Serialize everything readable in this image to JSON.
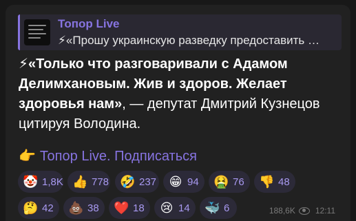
{
  "reply": {
    "title": "Топор Live",
    "text": "⚡«Прошу украинскую разведку предоставить …"
  },
  "message": {
    "emoji": "⚡",
    "bold_text": "«Только что разговаривали с Адамом Делимхановым. Жив и здоров. Желает здоровья нам»",
    "rest_text": ", — депутат Дмитрий Кузнецов цитируя Володина."
  },
  "subscribe": {
    "emoji": "👉",
    "link_text": "Топор Live. Подписаться"
  },
  "reactions": [
    {
      "icon": "clown-face-icon",
      "emoji": "🤡",
      "count": "1,8K"
    },
    {
      "icon": "thumbs-up-icon",
      "emoji": "👍",
      "count": "778"
    },
    {
      "icon": "rofl-icon",
      "emoji": "🤣",
      "count": "237"
    },
    {
      "icon": "grinning-face-icon",
      "emoji": "😁",
      "count": "94"
    },
    {
      "icon": "nauseated-face-icon",
      "emoji": "🤮",
      "count": "76"
    },
    {
      "icon": "thumbs-down-icon",
      "emoji": "👎",
      "count": "48"
    },
    {
      "icon": "thinking-face-icon",
      "emoji": "🤔",
      "count": "42"
    },
    {
      "icon": "poo-icon",
      "emoji": "💩",
      "count": "38"
    },
    {
      "icon": "heart-icon",
      "emoji": "❤️",
      "count": "18"
    },
    {
      "icon": "crying-face-icon",
      "emoji": "😢",
      "count": "14"
    },
    {
      "icon": "whale-icon",
      "emoji": "🐳",
      "count": "6"
    }
  ],
  "meta": {
    "views": "188,6K",
    "time": "12:11"
  },
  "colors": {
    "accent": "#8774e1",
    "background": "#212121",
    "chip": "#2c2a38"
  }
}
